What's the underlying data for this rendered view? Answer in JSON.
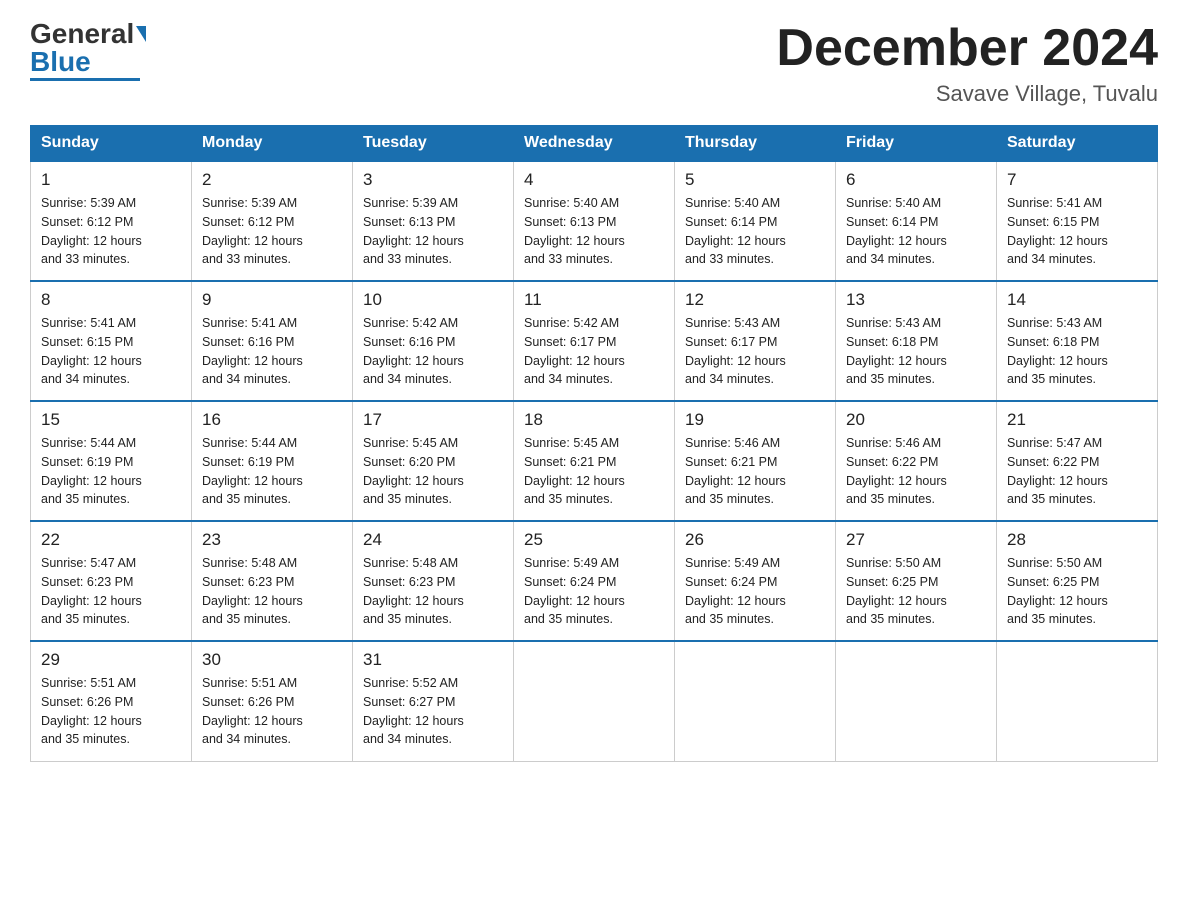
{
  "logo": {
    "general": "General",
    "blue": "Blue"
  },
  "title": "December 2024",
  "location": "Savave Village, Tuvalu",
  "days_of_week": [
    "Sunday",
    "Monday",
    "Tuesday",
    "Wednesday",
    "Thursday",
    "Friday",
    "Saturday"
  ],
  "weeks": [
    [
      {
        "num": "1",
        "sunrise": "5:39 AM",
        "sunset": "6:12 PM",
        "daylight": "12 hours and 33 minutes."
      },
      {
        "num": "2",
        "sunrise": "5:39 AM",
        "sunset": "6:12 PM",
        "daylight": "12 hours and 33 minutes."
      },
      {
        "num": "3",
        "sunrise": "5:39 AM",
        "sunset": "6:13 PM",
        "daylight": "12 hours and 33 minutes."
      },
      {
        "num": "4",
        "sunrise": "5:40 AM",
        "sunset": "6:13 PM",
        "daylight": "12 hours and 33 minutes."
      },
      {
        "num": "5",
        "sunrise": "5:40 AM",
        "sunset": "6:14 PM",
        "daylight": "12 hours and 33 minutes."
      },
      {
        "num": "6",
        "sunrise": "5:40 AM",
        "sunset": "6:14 PM",
        "daylight": "12 hours and 34 minutes."
      },
      {
        "num": "7",
        "sunrise": "5:41 AM",
        "sunset": "6:15 PM",
        "daylight": "12 hours and 34 minutes."
      }
    ],
    [
      {
        "num": "8",
        "sunrise": "5:41 AM",
        "sunset": "6:15 PM",
        "daylight": "12 hours and 34 minutes."
      },
      {
        "num": "9",
        "sunrise": "5:41 AM",
        "sunset": "6:16 PM",
        "daylight": "12 hours and 34 minutes."
      },
      {
        "num": "10",
        "sunrise": "5:42 AM",
        "sunset": "6:16 PM",
        "daylight": "12 hours and 34 minutes."
      },
      {
        "num": "11",
        "sunrise": "5:42 AM",
        "sunset": "6:17 PM",
        "daylight": "12 hours and 34 minutes."
      },
      {
        "num": "12",
        "sunrise": "5:43 AM",
        "sunset": "6:17 PM",
        "daylight": "12 hours and 34 minutes."
      },
      {
        "num": "13",
        "sunrise": "5:43 AM",
        "sunset": "6:18 PM",
        "daylight": "12 hours and 35 minutes."
      },
      {
        "num": "14",
        "sunrise": "5:43 AM",
        "sunset": "6:18 PM",
        "daylight": "12 hours and 35 minutes."
      }
    ],
    [
      {
        "num": "15",
        "sunrise": "5:44 AM",
        "sunset": "6:19 PM",
        "daylight": "12 hours and 35 minutes."
      },
      {
        "num": "16",
        "sunrise": "5:44 AM",
        "sunset": "6:19 PM",
        "daylight": "12 hours and 35 minutes."
      },
      {
        "num": "17",
        "sunrise": "5:45 AM",
        "sunset": "6:20 PM",
        "daylight": "12 hours and 35 minutes."
      },
      {
        "num": "18",
        "sunrise": "5:45 AM",
        "sunset": "6:21 PM",
        "daylight": "12 hours and 35 minutes."
      },
      {
        "num": "19",
        "sunrise": "5:46 AM",
        "sunset": "6:21 PM",
        "daylight": "12 hours and 35 minutes."
      },
      {
        "num": "20",
        "sunrise": "5:46 AM",
        "sunset": "6:22 PM",
        "daylight": "12 hours and 35 minutes."
      },
      {
        "num": "21",
        "sunrise": "5:47 AM",
        "sunset": "6:22 PM",
        "daylight": "12 hours and 35 minutes."
      }
    ],
    [
      {
        "num": "22",
        "sunrise": "5:47 AM",
        "sunset": "6:23 PM",
        "daylight": "12 hours and 35 minutes."
      },
      {
        "num": "23",
        "sunrise": "5:48 AM",
        "sunset": "6:23 PM",
        "daylight": "12 hours and 35 minutes."
      },
      {
        "num": "24",
        "sunrise": "5:48 AM",
        "sunset": "6:23 PM",
        "daylight": "12 hours and 35 minutes."
      },
      {
        "num": "25",
        "sunrise": "5:49 AM",
        "sunset": "6:24 PM",
        "daylight": "12 hours and 35 minutes."
      },
      {
        "num": "26",
        "sunrise": "5:49 AM",
        "sunset": "6:24 PM",
        "daylight": "12 hours and 35 minutes."
      },
      {
        "num": "27",
        "sunrise": "5:50 AM",
        "sunset": "6:25 PM",
        "daylight": "12 hours and 35 minutes."
      },
      {
        "num": "28",
        "sunrise": "5:50 AM",
        "sunset": "6:25 PM",
        "daylight": "12 hours and 35 minutes."
      }
    ],
    [
      {
        "num": "29",
        "sunrise": "5:51 AM",
        "sunset": "6:26 PM",
        "daylight": "12 hours and 35 minutes."
      },
      {
        "num": "30",
        "sunrise": "5:51 AM",
        "sunset": "6:26 PM",
        "daylight": "12 hours and 34 minutes."
      },
      {
        "num": "31",
        "sunrise": "5:52 AM",
        "sunset": "6:27 PM",
        "daylight": "12 hours and 34 minutes."
      },
      null,
      null,
      null,
      null
    ]
  ]
}
